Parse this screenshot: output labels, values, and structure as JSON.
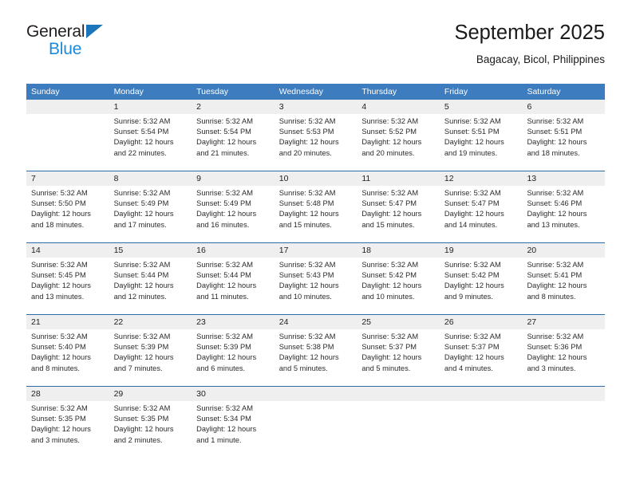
{
  "brand": {
    "name_part1": "General",
    "name_part2": "Blue",
    "triangle_color": "#1b75bb"
  },
  "header": {
    "title": "September 2025",
    "subtitle": "Bagacay, Bicol, Philippines"
  },
  "theme": {
    "header_blue": "#3c7cbf",
    "row_divider_blue": "#2d6ca8",
    "date_band_gray": "#efefef"
  },
  "weekdays": [
    "Sunday",
    "Monday",
    "Tuesday",
    "Wednesday",
    "Thursday",
    "Friday",
    "Saturday"
  ],
  "weeks": [
    {
      "days": [
        {
          "num": "",
          "lines": []
        },
        {
          "num": "1",
          "lines": [
            "Sunrise: 5:32 AM",
            "Sunset: 5:54 PM",
            "Daylight: 12 hours",
            "and 22 minutes."
          ]
        },
        {
          "num": "2",
          "lines": [
            "Sunrise: 5:32 AM",
            "Sunset: 5:54 PM",
            "Daylight: 12 hours",
            "and 21 minutes."
          ]
        },
        {
          "num": "3",
          "lines": [
            "Sunrise: 5:32 AM",
            "Sunset: 5:53 PM",
            "Daylight: 12 hours",
            "and 20 minutes."
          ]
        },
        {
          "num": "4",
          "lines": [
            "Sunrise: 5:32 AM",
            "Sunset: 5:52 PM",
            "Daylight: 12 hours",
            "and 20 minutes."
          ]
        },
        {
          "num": "5",
          "lines": [
            "Sunrise: 5:32 AM",
            "Sunset: 5:51 PM",
            "Daylight: 12 hours",
            "and 19 minutes."
          ]
        },
        {
          "num": "6",
          "lines": [
            "Sunrise: 5:32 AM",
            "Sunset: 5:51 PM",
            "Daylight: 12 hours",
            "and 18 minutes."
          ]
        }
      ]
    },
    {
      "days": [
        {
          "num": "7",
          "lines": [
            "Sunrise: 5:32 AM",
            "Sunset: 5:50 PM",
            "Daylight: 12 hours",
            "and 18 minutes."
          ]
        },
        {
          "num": "8",
          "lines": [
            "Sunrise: 5:32 AM",
            "Sunset: 5:49 PM",
            "Daylight: 12 hours",
            "and 17 minutes."
          ]
        },
        {
          "num": "9",
          "lines": [
            "Sunrise: 5:32 AM",
            "Sunset: 5:49 PM",
            "Daylight: 12 hours",
            "and 16 minutes."
          ]
        },
        {
          "num": "10",
          "lines": [
            "Sunrise: 5:32 AM",
            "Sunset: 5:48 PM",
            "Daylight: 12 hours",
            "and 15 minutes."
          ]
        },
        {
          "num": "11",
          "lines": [
            "Sunrise: 5:32 AM",
            "Sunset: 5:47 PM",
            "Daylight: 12 hours",
            "and 15 minutes."
          ]
        },
        {
          "num": "12",
          "lines": [
            "Sunrise: 5:32 AM",
            "Sunset: 5:47 PM",
            "Daylight: 12 hours",
            "and 14 minutes."
          ]
        },
        {
          "num": "13",
          "lines": [
            "Sunrise: 5:32 AM",
            "Sunset: 5:46 PM",
            "Daylight: 12 hours",
            "and 13 minutes."
          ]
        }
      ]
    },
    {
      "days": [
        {
          "num": "14",
          "lines": [
            "Sunrise: 5:32 AM",
            "Sunset: 5:45 PM",
            "Daylight: 12 hours",
            "and 13 minutes."
          ]
        },
        {
          "num": "15",
          "lines": [
            "Sunrise: 5:32 AM",
            "Sunset: 5:44 PM",
            "Daylight: 12 hours",
            "and 12 minutes."
          ]
        },
        {
          "num": "16",
          "lines": [
            "Sunrise: 5:32 AM",
            "Sunset: 5:44 PM",
            "Daylight: 12 hours",
            "and 11 minutes."
          ]
        },
        {
          "num": "17",
          "lines": [
            "Sunrise: 5:32 AM",
            "Sunset: 5:43 PM",
            "Daylight: 12 hours",
            "and 10 minutes."
          ]
        },
        {
          "num": "18",
          "lines": [
            "Sunrise: 5:32 AM",
            "Sunset: 5:42 PM",
            "Daylight: 12 hours",
            "and 10 minutes."
          ]
        },
        {
          "num": "19",
          "lines": [
            "Sunrise: 5:32 AM",
            "Sunset: 5:42 PM",
            "Daylight: 12 hours",
            "and 9 minutes."
          ]
        },
        {
          "num": "20",
          "lines": [
            "Sunrise: 5:32 AM",
            "Sunset: 5:41 PM",
            "Daylight: 12 hours",
            "and 8 minutes."
          ]
        }
      ]
    },
    {
      "days": [
        {
          "num": "21",
          "lines": [
            "Sunrise: 5:32 AM",
            "Sunset: 5:40 PM",
            "Daylight: 12 hours",
            "and 8 minutes."
          ]
        },
        {
          "num": "22",
          "lines": [
            "Sunrise: 5:32 AM",
            "Sunset: 5:39 PM",
            "Daylight: 12 hours",
            "and 7 minutes."
          ]
        },
        {
          "num": "23",
          "lines": [
            "Sunrise: 5:32 AM",
            "Sunset: 5:39 PM",
            "Daylight: 12 hours",
            "and 6 minutes."
          ]
        },
        {
          "num": "24",
          "lines": [
            "Sunrise: 5:32 AM",
            "Sunset: 5:38 PM",
            "Daylight: 12 hours",
            "and 5 minutes."
          ]
        },
        {
          "num": "25",
          "lines": [
            "Sunrise: 5:32 AM",
            "Sunset: 5:37 PM",
            "Daylight: 12 hours",
            "and 5 minutes."
          ]
        },
        {
          "num": "26",
          "lines": [
            "Sunrise: 5:32 AM",
            "Sunset: 5:37 PM",
            "Daylight: 12 hours",
            "and 4 minutes."
          ]
        },
        {
          "num": "27",
          "lines": [
            "Sunrise: 5:32 AM",
            "Sunset: 5:36 PM",
            "Daylight: 12 hours",
            "and 3 minutes."
          ]
        }
      ]
    },
    {
      "days": [
        {
          "num": "28",
          "lines": [
            "Sunrise: 5:32 AM",
            "Sunset: 5:35 PM",
            "Daylight: 12 hours",
            "and 3 minutes."
          ]
        },
        {
          "num": "29",
          "lines": [
            "Sunrise: 5:32 AM",
            "Sunset: 5:35 PM",
            "Daylight: 12 hours",
            "and 2 minutes."
          ]
        },
        {
          "num": "30",
          "lines": [
            "Sunrise: 5:32 AM",
            "Sunset: 5:34 PM",
            "Daylight: 12 hours",
            "and 1 minute."
          ]
        },
        {
          "num": "",
          "lines": []
        },
        {
          "num": "",
          "lines": []
        },
        {
          "num": "",
          "lines": []
        },
        {
          "num": "",
          "lines": []
        }
      ]
    }
  ]
}
